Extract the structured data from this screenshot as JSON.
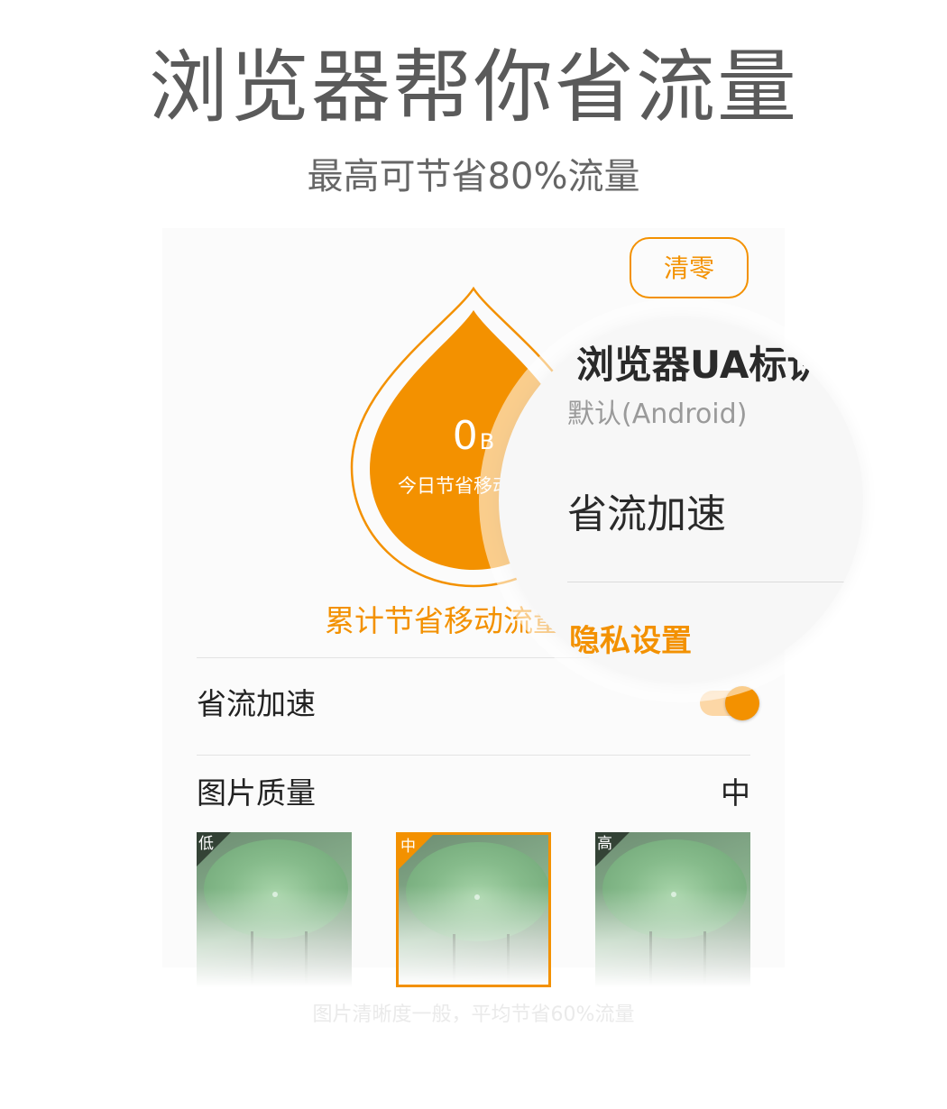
{
  "promo": {
    "headline": "浏览器帮你省流量",
    "subline": "最高可节省80%流量"
  },
  "card": {
    "reset_button": "清零",
    "drop": {
      "value": "0",
      "unit": "B",
      "caption": "今日节省移动流量"
    },
    "total_label": "累计节省移动流量",
    "data_saver": {
      "label": "省流加速",
      "enabled": true
    },
    "image_quality": {
      "label": "图片质量",
      "value": "中",
      "options": [
        {
          "label": "低",
          "selected": false
        },
        {
          "label": "中",
          "selected": true
        },
        {
          "label": "高",
          "selected": false
        }
      ]
    },
    "footnote": "图片清晰度一般，平均节省60%流量"
  },
  "magnifier": {
    "title": "浏览器UA标识",
    "subtitle": "默认(Android)",
    "item": "省流加速",
    "section": "隐私设置"
  },
  "colors": {
    "accent": "#f39100",
    "accent_light": "#fcd7a6",
    "text_dark": "#222222",
    "text_gray": "#666666"
  },
  "icons": {
    "drop": "water-drop-icon",
    "toggle": "toggle-switch"
  }
}
